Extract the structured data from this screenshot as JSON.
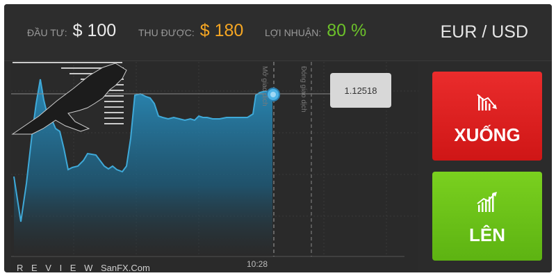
{
  "header": {
    "invest_label": "ĐẦU TƯ:",
    "invest_value": "$ 100",
    "payout_label": "THU ĐƯỢC:",
    "payout_value": "$ 180",
    "profit_label": "LỢI NHUẬN:",
    "profit_value": "80 %",
    "pair": "EUR / USD"
  },
  "chart": {
    "current_price": "1.12518",
    "open_line_label": "Mở giao dịch",
    "close_line_label": "Đóng giao dịch",
    "time_label": "10:28"
  },
  "buttons": {
    "down_label": "XUỐNG",
    "up_label": "LÊN"
  },
  "watermark": {
    "prefix": "R E V I E W",
    "brand": "SanFX.Com"
  },
  "colors": {
    "payout": "#f5a623",
    "profit": "#6cc12a",
    "down": "#e02121",
    "up": "#6cc118",
    "series": "#3fa9d8"
  },
  "icons": {
    "down": "trend-down-chart-icon",
    "up": "trend-up-chart-icon",
    "marker": "price-marker-icon"
  }
}
